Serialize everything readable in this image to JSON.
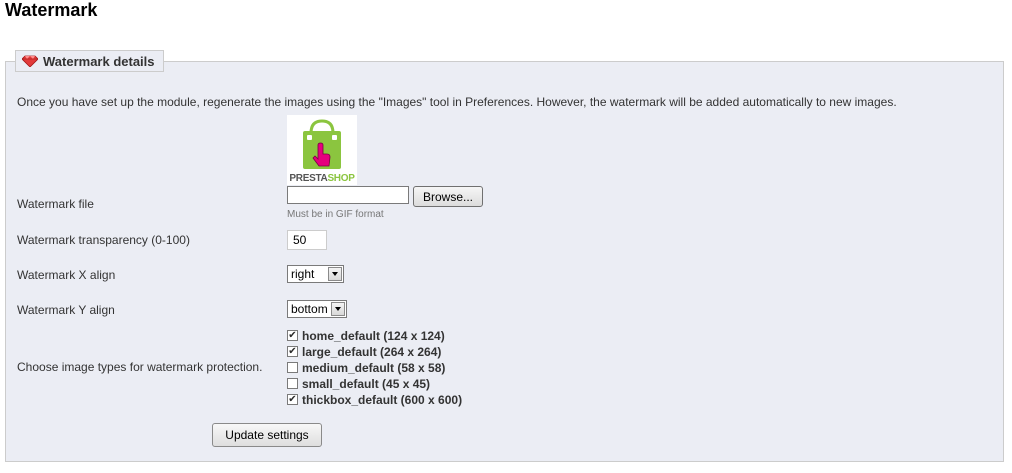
{
  "page": {
    "title": "Watermark"
  },
  "panel": {
    "legend": "Watermark details",
    "legend_icon": "ruby-gem-icon",
    "intro": "Once you have set up the module, regenerate the images using the \"Images\" tool in Preferences. However, the watermark will be added automatically to new images."
  },
  "watermark_file": {
    "label": "Watermark file",
    "preview_logo_text": "PRESTASHOP",
    "file_value": "",
    "browse_label": "Browse...",
    "hint": "Must be in GIF format"
  },
  "transparency": {
    "label": "Watermark transparency (0-100)",
    "value": "50"
  },
  "x_align": {
    "label": "Watermark X align",
    "selected": "right"
  },
  "y_align": {
    "label": "Watermark Y align",
    "selected": "bottom"
  },
  "image_types": {
    "label": "Choose image types for watermark protection.",
    "items": [
      {
        "label": "home_default (124 x 124)",
        "checked": true
      },
      {
        "label": "large_default (264 x 264)",
        "checked": true
      },
      {
        "label": "medium_default (58 x 58)",
        "checked": false
      },
      {
        "label": "small_default (45 x 45)",
        "checked": false
      },
      {
        "label": "thickbox_default (600 x 600)",
        "checked": true
      }
    ]
  },
  "submit": {
    "label": "Update settings"
  },
  "colors": {
    "panel_bg": "#ebedf4",
    "panel_border": "#cccccc",
    "logo_green": "#8bc53f",
    "logo_pink": "#e6007e"
  }
}
